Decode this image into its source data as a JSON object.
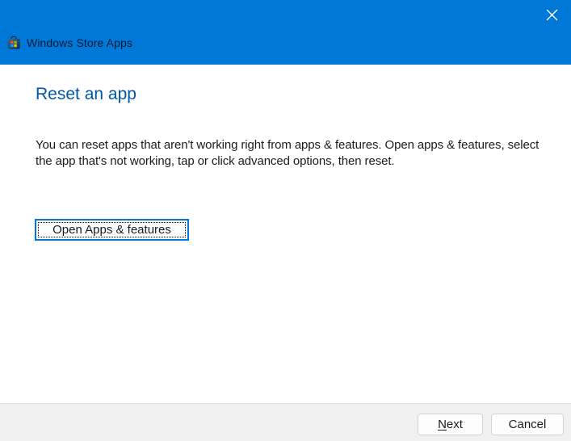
{
  "header": {
    "app_title": "Windows Store Apps"
  },
  "content": {
    "heading": "Reset an app",
    "description": "You can reset apps that aren't working right from apps & features. Open apps & features, select the app that's not working, tap or click advanced options, then reset.",
    "open_button_label": "Open Apps & features"
  },
  "footer": {
    "next_accesskey": "N",
    "next_rest": "ext",
    "cancel_label": "Cancel"
  },
  "icons": {
    "store_icon": "microsoft-store-icon",
    "close_icon": "close-icon"
  },
  "colors": {
    "header_background": "#0078D7",
    "header_title_text": "#001B36",
    "heading_text": "#0057A8",
    "body_text": "#1B1B1B",
    "focus_border": "#0078D7",
    "footer_background": "#F0F0F0",
    "button_background": "#FDFDFD",
    "button_border": "#D2D2D2",
    "ms_logo_red": "#F25022",
    "ms_logo_green": "#7FBA00",
    "ms_logo_blue": "#00A4EF",
    "ms_logo_yellow": "#FFB900"
  }
}
